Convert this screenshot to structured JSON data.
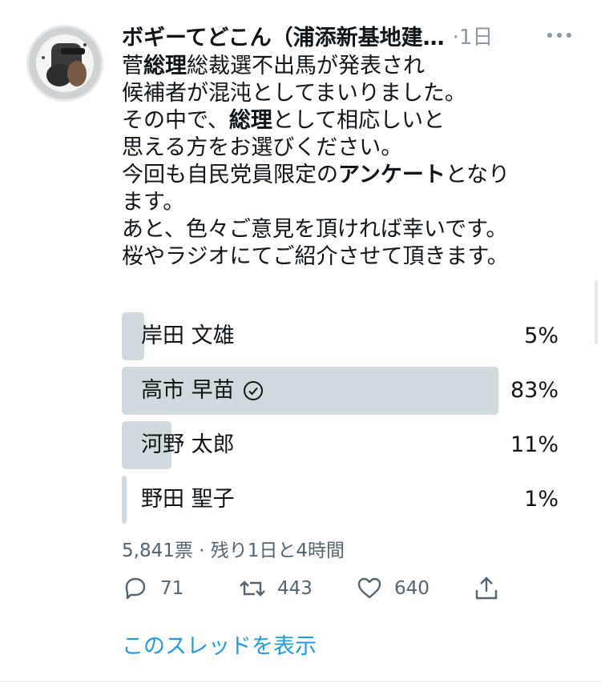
{
  "tweet": {
    "display_name": "ボギーてどこん（浦添新基地建…",
    "time": "·1日",
    "lines": [
      [
        "菅",
        "総理",
        "総裁選不出馬が発表され"
      ],
      [
        "候補者が混沌としてまいりました。"
      ],
      [
        "その中で、",
        "総理",
        "として相応しいと"
      ],
      [
        "思える方をお選びください。"
      ],
      [
        "今回も自民党員限定の",
        "アンケート",
        "となり"
      ],
      [
        "ます。"
      ],
      [
        "あと、色々ご意見を頂ければ幸いです。"
      ],
      [
        "桜やラジオにてご紹介させて頂きます。"
      ]
    ]
  },
  "poll": {
    "options": [
      {
        "label": "岸田 文雄",
        "pct_text": "5%",
        "pct": 5,
        "winner": false
      },
      {
        "label": "高市 早苗",
        "pct_text": "83%",
        "pct": 83,
        "winner": true
      },
      {
        "label": "河野 太郎",
        "pct_text": "11%",
        "pct": 11,
        "winner": false
      },
      {
        "label": "野田 聖子",
        "pct_text": "1%",
        "pct": 1,
        "winner": false
      }
    ],
    "meta": "5,841票 · 残り1日と4時間"
  },
  "actions": {
    "reply_count": "71",
    "retweet_count": "443",
    "like_count": "640"
  },
  "thread_link": "このスレッドを表示",
  "colors": {
    "accent": "#1d9bf0",
    "bar": "#cfd9de",
    "muted": "#536471"
  },
  "icons": {
    "more": "more-dots-icon",
    "reply": "reply-bubble-icon",
    "retweet": "retweet-icon",
    "like": "heart-icon",
    "share": "share-icon",
    "winner": "check-circle-icon"
  }
}
